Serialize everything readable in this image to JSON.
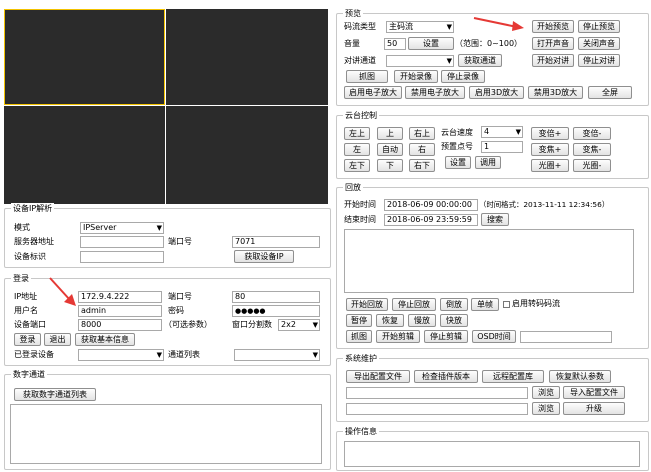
{
  "preview": {
    "legend": "预览",
    "stream_type_label": "码流类型",
    "stream_type_value": "主码流",
    "start_preview": "开始预览",
    "stop_preview": "停止预览",
    "volume_label": "音量",
    "volume_value": "50",
    "volume_set": "设置",
    "volume_range": "（范围：0~100）",
    "open_sound": "打开声音",
    "close_sound": "关闭声音",
    "talk_channel_label": "对讲通道",
    "talk_channel_value": "",
    "get_channel": "获取通道",
    "start_talk": "开始对讲",
    "stop_talk": "停止对讲",
    "capture": "抓图",
    "start_record": "开始录像",
    "stop_record": "停止录像",
    "enable_ezoom": "启用电子放大",
    "disable_ezoom": "禁用电子放大",
    "enable_3d": "启用3D放大",
    "disable_3d": "禁用3D放大",
    "fullscreen": "全屏"
  },
  "ptz": {
    "legend": "云台控制",
    "up_left": "左上",
    "up": "上",
    "up_right": "右上",
    "left": "左",
    "auto": "自动",
    "right": "右",
    "down_left": "左下",
    "down": "下",
    "down_right": "右下",
    "speed_label": "云台速度",
    "speed_value": "4",
    "preset_label": "预置点号",
    "preset_value": "1",
    "set": "设置",
    "call": "调用",
    "zoom_in": "变倍+",
    "zoom_out": "变倍-",
    "focus_in": "变焦+",
    "focus_out": "变焦-",
    "iris_in": "光圈+",
    "iris_out": "光圈-"
  },
  "playback": {
    "legend": "回放",
    "start_label": "开始时间",
    "start_value": "2018-06-09 00:00:00",
    "time_format": "（时间格式：2013-11-11 12:34:56）",
    "end_label": "结束时间",
    "end_value": "2018-06-09 23:59:59",
    "search": "搜索",
    "start_playback": "开始回放",
    "stop_playback": "停止回放",
    "reverse": "倒放",
    "single_frame": "单帧",
    "enable_transcode": "启用转码码流",
    "pause": "暂停",
    "resume": "恢复",
    "slow": "慢放",
    "fast": "快放",
    "capture": "抓图",
    "start_clip": "开始剪辑",
    "stop_clip": "停止剪辑",
    "osd_time": "OSD时间"
  },
  "maintenance": {
    "legend": "系统维护",
    "export_config": "导出配置文件",
    "check_plugin": "检查插件版本",
    "remote_config": "远程配置库",
    "restore_default": "恢复默认参数",
    "browse": "浏览",
    "import_config": "导入配置文件",
    "browse2": "浏览",
    "upgrade": "升级"
  },
  "operation_info": {
    "legend": "操作信息"
  },
  "ip_parse": {
    "legend": "设备IP解析",
    "mode_label": "模式",
    "mode_value": "IPServer",
    "server_addr_label": "服务器地址",
    "server_addr_value": "",
    "port_label": "端口号",
    "port_value": "7071",
    "device_id_label": "设备标识",
    "device_id_value": "",
    "get_device_ip": "获取设备IP"
  },
  "login": {
    "legend": "登录",
    "ip_label": "IP地址",
    "ip_value": "172.9.4.222",
    "port_label": "端口号",
    "port_value": "80",
    "user_label": "用户名",
    "user_value": "admin",
    "password_label": "密码",
    "password_value": "●●●●●",
    "device_port_label": "设备端口",
    "device_port_value": "8000",
    "optional": "（可选参数）",
    "split_label": "窗口分割数",
    "split_value": "2x2",
    "login_btn": "登录",
    "logout_btn": "退出",
    "get_info": "获取基本信息",
    "logged_devices_label": "已登录设备",
    "logged_devices_value": "",
    "channel_list_label": "通道列表",
    "channel_list_value": ""
  },
  "digital_channel": {
    "legend": "数字通道",
    "get_list": "获取数字通道列表"
  },
  "colors": {
    "selected_window_border": "#f2c200",
    "annotation_arrow": "#e53935",
    "video_background": "#2b2b2b"
  }
}
